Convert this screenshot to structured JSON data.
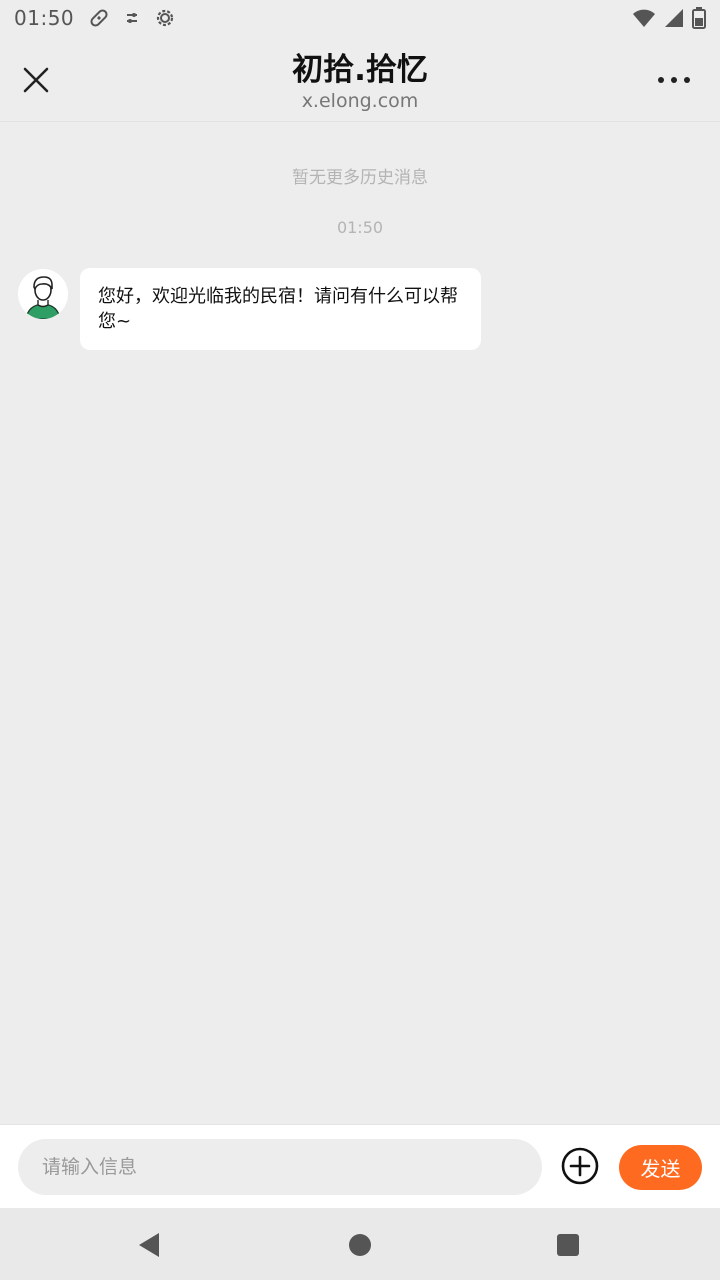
{
  "status_bar": {
    "time": "01:50",
    "icons": [
      "health-icon",
      "data-saver-icon",
      "settings-icon",
      "wifi-icon",
      "signal-icon",
      "battery-icon"
    ]
  },
  "header": {
    "title": "初拾.拾忆",
    "subtitle": "x.elong.com"
  },
  "chat": {
    "no_more_history": "暂无更多历史消息",
    "timestamp": "01:50",
    "messages": [
      {
        "sender": "host",
        "text": "您好，欢迎光临我的民宿！请问有什么可以帮您~"
      }
    ]
  },
  "input_bar": {
    "placeholder": "请输入信息",
    "value": "",
    "send_label": "发送"
  },
  "colors": {
    "background": "#ededed",
    "accent": "#ff6a21",
    "avatar_shirt": "#2e9e64"
  }
}
